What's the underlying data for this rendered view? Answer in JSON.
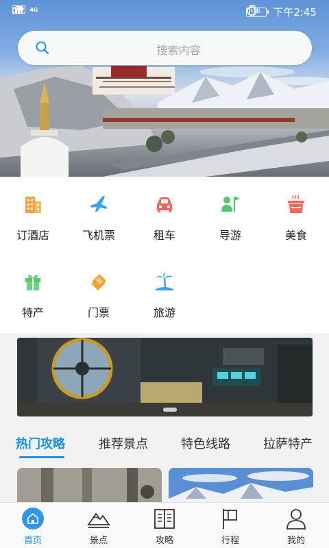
{
  "status_bar": {
    "network_badge": "HD",
    "signal_label": "4G",
    "battery": "76",
    "time": "下午2:45"
  },
  "search": {
    "placeholder": "搜索内容"
  },
  "categories": [
    {
      "label": "订酒店",
      "icon": "hotel-icon",
      "color": "#f7a238"
    },
    {
      "label": "飞机票",
      "icon": "airplane-icon",
      "color": "#3aa3ec"
    },
    {
      "label": "租车",
      "icon": "car-icon",
      "color": "#f5675e"
    },
    {
      "label": "导游",
      "icon": "guide-icon",
      "color": "#55c86b"
    },
    {
      "label": "美食",
      "icon": "food-pot-icon",
      "color": "#f5675e"
    },
    {
      "label": "特产",
      "icon": "gift-icon",
      "color": "#55c86b"
    },
    {
      "label": "门票",
      "icon": "ticket-icon",
      "color": "#f7a238"
    },
    {
      "label": "旅游",
      "icon": "palm-island-icon",
      "color": "#3aa3ec"
    }
  ],
  "tabs": [
    {
      "label": "热门攻略",
      "active": true
    },
    {
      "label": "推荐景点",
      "active": false
    },
    {
      "label": "特色线路",
      "active": false
    },
    {
      "label": "拉萨特产",
      "active": false
    }
  ],
  "bottom_nav": [
    {
      "label": "首页",
      "icon": "home-icon",
      "active": true
    },
    {
      "label": "景点",
      "icon": "mountain-icon",
      "active": false
    },
    {
      "label": "攻略",
      "icon": "book-icon",
      "active": false
    },
    {
      "label": "行程",
      "icon": "flag-icon",
      "active": false
    },
    {
      "label": "我的",
      "icon": "user-icon",
      "active": false
    }
  ],
  "colors": {
    "accent": "#1a8fe0"
  }
}
